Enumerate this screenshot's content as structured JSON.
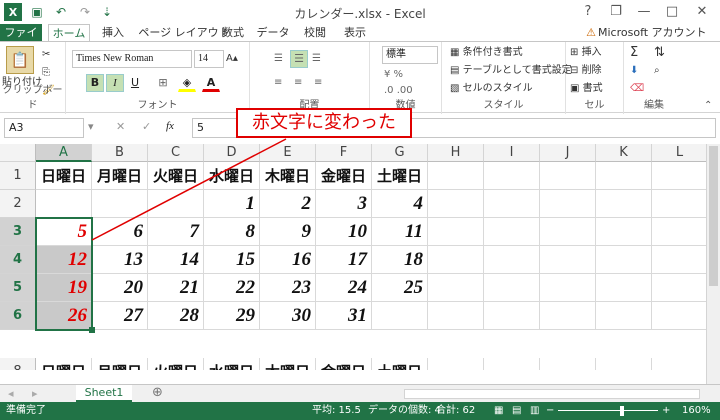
{
  "titlebar": {
    "title": "カレンダー.xlsx - Excel",
    "help": "?",
    "restore": "❐",
    "minimize": "—",
    "maximize": "□",
    "close": "✕"
  },
  "tabs": {
    "file": "ファイル",
    "home": "ホーム",
    "insert": "挿入",
    "pagelayout": "ページ レイアウト",
    "formulas": "数式",
    "data": "データ",
    "review": "校閲",
    "view": "表示",
    "account": "Microsoft アカウント"
  },
  "ribbon": {
    "paste_label": "貼り付け",
    "clipboard_label": "クリップボード",
    "font_name": "Times New Roman",
    "font_size": "14",
    "bold": "B",
    "italic": "I",
    "underline": "U",
    "font_color_label": "A",
    "font_group": "フォント",
    "alignment_group": "配置",
    "number_format": "標準",
    "number_group": "数値",
    "cond_format": "条件付き書式",
    "table_format": "テーブルとして書式設定",
    "cell_style": "セルのスタイル",
    "styles_group": "スタイル",
    "insert": "挿入",
    "delete": "削除",
    "format": "書式",
    "cells_group": "セル",
    "editing_group": "編集"
  },
  "formula_bar": {
    "name_box": "A3",
    "fx": "fx",
    "value": "5"
  },
  "callout": "赤文字に変わった",
  "columns": [
    "A",
    "B",
    "C",
    "D",
    "E",
    "F",
    "G",
    "H",
    "I",
    "J",
    "K",
    "L"
  ],
  "rows": [
    "1",
    "2",
    "3",
    "4",
    "5",
    "6",
    "8"
  ],
  "weekdays": [
    "日曜日",
    "月曜日",
    "火曜日",
    "水曜日",
    "木曜日",
    "金曜日",
    "土曜日"
  ],
  "week1": [
    "",
    "",
    "",
    "1",
    "2",
    "3",
    "4"
  ],
  "week2": [
    "5",
    "6",
    "7",
    "8",
    "9",
    "10",
    "11"
  ],
  "week3": [
    "12",
    "13",
    "14",
    "15",
    "16",
    "17",
    "18"
  ],
  "week4": [
    "19",
    "20",
    "21",
    "22",
    "23",
    "24",
    "25"
  ],
  "week5": [
    "26",
    "27",
    "28",
    "29",
    "30",
    "31",
    ""
  ],
  "sheet": {
    "tab": "Sheet1",
    "add": "⊕"
  },
  "status": {
    "ready": "準備完了",
    "average": "平均: 15.5",
    "count": "データの個数: 4",
    "sum": "合計: 62",
    "zoom": "160%"
  },
  "colors": {
    "accent": "#217346",
    "red_text": "#e00000"
  }
}
